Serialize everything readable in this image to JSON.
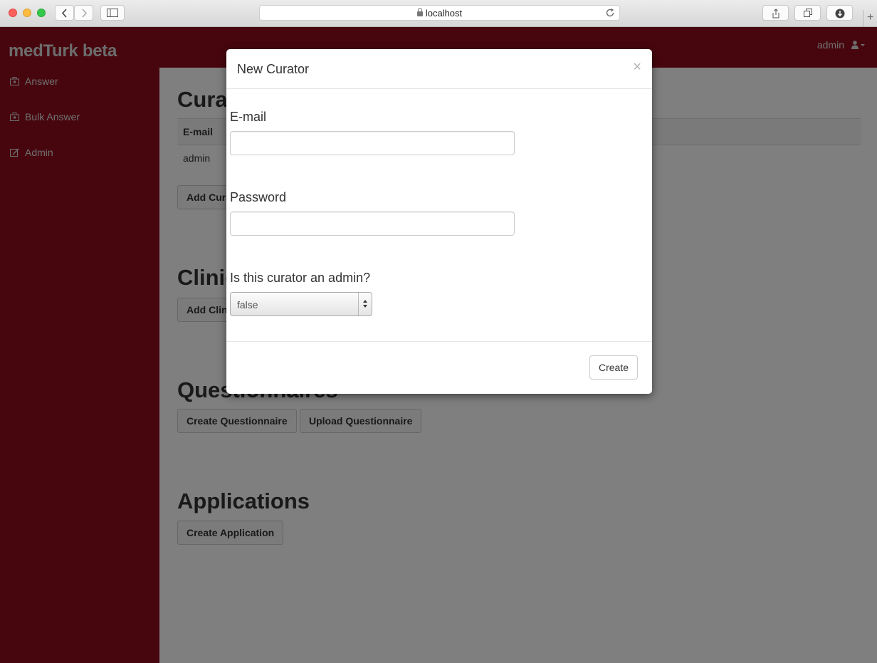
{
  "browser": {
    "url": "localhost",
    "new_tab": "+"
  },
  "app": {
    "brand": "medTurk beta",
    "user": "admin"
  },
  "sidebar": {
    "items": [
      {
        "label": "Answer",
        "icon": "briefcase-icon"
      },
      {
        "label": "Bulk Answer",
        "icon": "briefcase-icon"
      },
      {
        "label": "Admin",
        "icon": "edit-icon"
      }
    ]
  },
  "main": {
    "curators": {
      "title": "Curators",
      "column_email": "E-mail",
      "rows": [
        "admin"
      ],
      "add_button": "Add Curator"
    },
    "clinicians": {
      "title": "Clinicians",
      "add_button": "Add Clinician"
    },
    "questionnaires": {
      "title": "Questionnaires",
      "create_button": "Create Questionnaire",
      "upload_button": "Upload Questionnaire"
    },
    "applications": {
      "title": "Applications",
      "create_button": "Create Application"
    }
  },
  "modal": {
    "title": "New Curator",
    "close": "×",
    "email_label": "E-mail",
    "email_value": "",
    "password_label": "Password",
    "password_value": "",
    "admin_label": "Is this curator an admin?",
    "admin_selected": "false",
    "create_button": "Create"
  },
  "colors": {
    "brand_red": "#8e0c1c",
    "backdrop": "rgba(0,0,0,0.5)"
  }
}
